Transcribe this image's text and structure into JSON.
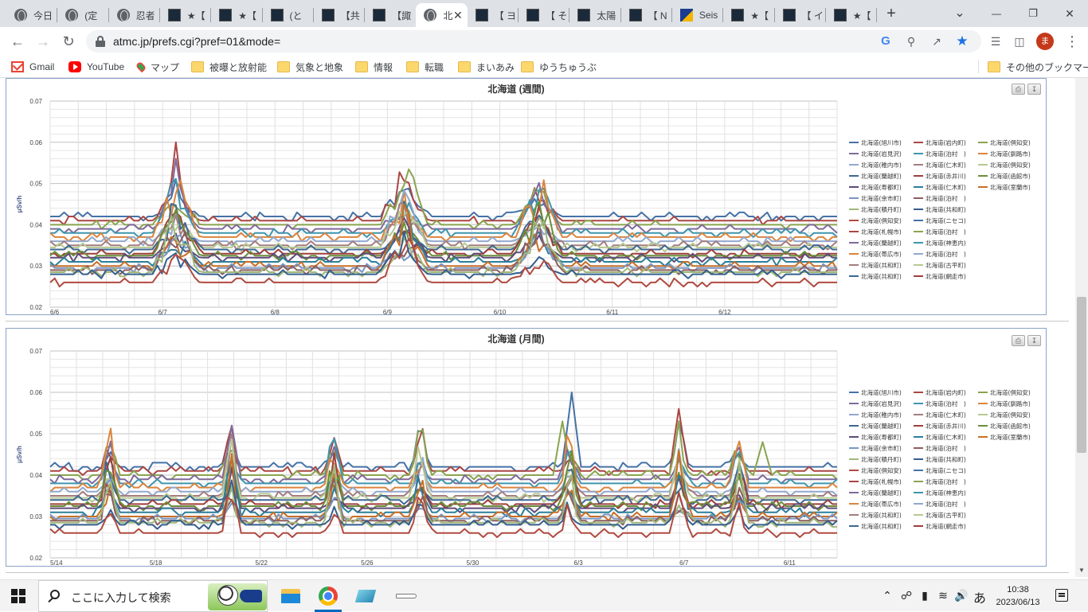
{
  "browser": {
    "tabs": [
      {
        "title": "今日",
        "icon": "globe-icon"
      },
      {
        "title": "(定",
        "icon": "globe-icon"
      },
      {
        "title": "忍者",
        "icon": "globe-icon"
      },
      {
        "title": "★【",
        "icon": "jma-icon"
      },
      {
        "title": "★【",
        "icon": "jma-icon"
      },
      {
        "title": "(と",
        "icon": "jma-icon"
      },
      {
        "title": "【共",
        "icon": "jma-icon"
      },
      {
        "title": "【諏",
        "icon": "jma-icon"
      },
      {
        "title": "北",
        "icon": "globe-icon",
        "active": true
      },
      {
        "title": "【 ヨ",
        "icon": "jma-icon"
      },
      {
        "title": "【 そ",
        "icon": "jma-icon"
      },
      {
        "title": "太陽",
        "icon": "jma-icon"
      },
      {
        "title": "【 N",
        "icon": "jma-icon"
      },
      {
        "title": "Seis",
        "icon": "seis-icon"
      },
      {
        "title": "★【",
        "icon": "jma-icon"
      },
      {
        "title": "【 イ",
        "icon": "jma-icon"
      },
      {
        "title": "★【",
        "icon": "jma-icon"
      }
    ],
    "url": "atmc.jp/prefs.cgi?pref=01&mode=",
    "profile_initial": "ま",
    "bookmarks": [
      {
        "label": "Gmail",
        "icon": "gmail-icon"
      },
      {
        "label": "YouTube",
        "icon": "youtube-icon"
      },
      {
        "label": "マップ",
        "icon": "maps-icon"
      },
      {
        "label": "被曝と放射能",
        "icon": "folder-icon"
      },
      {
        "label": "気象と地象",
        "icon": "folder-icon"
      },
      {
        "label": "情報",
        "icon": "folder-icon"
      },
      {
        "label": "転職",
        "icon": "folder-icon"
      },
      {
        "label": "まいあみ",
        "icon": "folder-icon"
      },
      {
        "label": "ゆうちゅうぶ",
        "icon": "folder-icon"
      }
    ],
    "other_bookmarks": "その他のブックマーク"
  },
  "legend_labels": [
    "北海道(旭川市)",
    "北海道(岩内町)",
    "北海道(倶知安)",
    "北海道(岩見沢)",
    "北海道(泊村　)",
    "北海道(釧路市)",
    "北海道(稚内市)",
    "北海道(仁木町)",
    "北海道(倶知安)",
    "北海道(蘭越町)",
    "北海道(赤井川)",
    "北海道(函館市)",
    "北海道(寿都町)",
    "北海道(仁木町)",
    "北海道(室蘭市)",
    "北海道(余市町)",
    "北海道(泊村　)",
    "北海道(積丹町)",
    "北海道(共和町)",
    "北海道(倶知安)",
    "北海道(ニセコ)",
    "北海道(札幌市)",
    "北海道(泊村　)",
    "北海道(蘭越町)",
    "北海道(神恵内)",
    "北海道(帯広市)",
    "北海道(泊村　)",
    "北海道(共和町)",
    "北海道(古平町)",
    "北海道(共和町)",
    "北海道(網走市)"
  ],
  "series_colors": [
    "#4572a7",
    "#aa4643",
    "#89a54e",
    "#80699b",
    "#3d96ae",
    "#db843d",
    "#92a8cd",
    "#a47d7c",
    "#b5ca92",
    "#3e6794",
    "#9d3f3c",
    "#6a8f3a",
    "#604a7b",
    "#2b7f99",
    "#c86f26",
    "#7a95c2",
    "#8d5e5d",
    "#9fb97a",
    "#345e8e",
    "#b04a40"
  ],
  "charts": [
    {
      "title": "北海道 (週間)",
      "print_icon": "printer-icon",
      "export_icon": "download-icon",
      "y_unit_label": "μSv/h",
      "x_tick_labels": [
        "6/6",
        "6/7",
        "6/8",
        "6/9",
        "6/10",
        "6/11",
        "6/12"
      ],
      "y_tick_labels": [
        "0.07",
        "0.06",
        "0.05",
        "0.04",
        "0.03",
        "0.02"
      ]
    },
    {
      "title": "北海道 (月間)",
      "print_icon": "printer-icon",
      "export_icon": "download-icon",
      "y_unit_label": "μSv/h",
      "x_tick_labels": [
        "5/14",
        "5/18",
        "5/22",
        "5/26",
        "5/30",
        "6/3",
        "6/7",
        "6/11"
      ],
      "y_tick_labels": [
        "0.07",
        "0.06",
        "0.05",
        "0.04",
        "0.03",
        "0.02"
      ]
    }
  ],
  "chart_data": [
    {
      "type": "line",
      "title": "北海道 (週間)",
      "ylabel": "μSv/h",
      "ylim": [
        0.02,
        0.07
      ],
      "x_range": [
        "6/6",
        "6/13"
      ],
      "grid": true,
      "legend": "right",
      "baselines": [
        0.042,
        0.041,
        0.04,
        0.039,
        0.038,
        0.037,
        0.036,
        0.035,
        0.0345,
        0.034,
        0.033,
        0.0325,
        0.032,
        0.031,
        0.03,
        0.0295,
        0.029,
        0.0285,
        0.028,
        0.026
      ],
      "peaks": [
        {
          "series": 1,
          "x": "6/7",
          "value": 0.06
        },
        {
          "series": 3,
          "x": "6/7",
          "value": 0.056
        },
        {
          "series": 0,
          "x": "6/7",
          "value": 0.051
        },
        {
          "series": 2,
          "x": "6/10",
          "value": 0.056
        },
        {
          "series": 2,
          "x": "6/10",
          "value": 0.048
        },
        {
          "series": 0,
          "x": "6/9",
          "value": 0.046
        }
      ]
    },
    {
      "type": "line",
      "title": "北海道 (月間)",
      "ylabel": "μSv/h",
      "ylim": [
        0.02,
        0.07
      ],
      "x_range": [
        "5/14",
        "6/13"
      ],
      "grid": true,
      "legend": "right",
      "baselines": [
        0.042,
        0.041,
        0.04,
        0.039,
        0.038,
        0.037,
        0.036,
        0.035,
        0.0345,
        0.034,
        0.033,
        0.0325,
        0.032,
        0.031,
        0.03,
        0.0295,
        0.029,
        0.0285,
        0.028,
        0.026
      ],
      "peaks": [
        {
          "series": 0,
          "x": "6/3",
          "value": 0.06
        },
        {
          "series": 1,
          "x": "6/7",
          "value": 0.056
        },
        {
          "series": 3,
          "x": "5/21",
          "value": 0.052
        },
        {
          "series": 2,
          "x": "6/2",
          "value": 0.053
        },
        {
          "series": 1,
          "x": "5/25",
          "value": 0.049
        },
        {
          "series": 2,
          "x": "6/10",
          "value": 0.048
        }
      ]
    }
  ],
  "taskbar": {
    "search_placeholder": "ここに入力して検索",
    "time": "10:38",
    "date": "2023/06/13",
    "ime": "あ"
  }
}
